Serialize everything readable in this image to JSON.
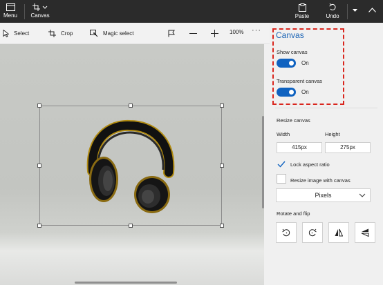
{
  "ribbon": {
    "menu_label": "Menu",
    "canvas_label": "Canvas",
    "paste_label": "Paste",
    "undo_label": "Undo"
  },
  "toolbar": {
    "select_label": "Select",
    "crop_label": "Crop",
    "magic_select_label": "Magic select",
    "zoom": "100%",
    "more": "···"
  },
  "pane": {
    "title": "Canvas",
    "show_canvas": {
      "label": "Show canvas",
      "state": "On"
    },
    "transparent_canvas": {
      "label": "Transparent canvas",
      "state": "On"
    },
    "resize_heading": "Resize canvas",
    "width_label": "Width",
    "height_label": "Height",
    "width_value": "415px",
    "height_value": "275px",
    "lock_aspect_label": "Lock aspect ratio",
    "lock_aspect_checked": true,
    "resize_image_label": "Resize image with canvas",
    "resize_image_checked": false,
    "units_value": "Pixels",
    "rotate_heading": "Rotate and flip"
  },
  "colors": {
    "ribbon_bg": "#2b2b2b",
    "accent": "#0f62c0",
    "title_blue": "#1a63b5",
    "highlight_red": "#d9251d"
  }
}
